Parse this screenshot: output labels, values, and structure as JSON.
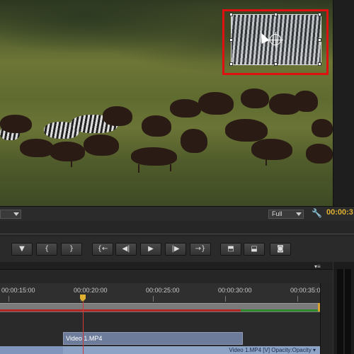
{
  "monitor": {
    "zoom_value": "Full",
    "timecode": "00:00:3",
    "left_dropdown": ""
  },
  "transport": {
    "buttons": [
      {
        "name": "add-marker",
        "glyph": "▼"
      },
      {
        "name": "mark-in",
        "glyph": "{"
      },
      {
        "name": "mark-out",
        "glyph": "}"
      },
      {
        "name": "go-to-in",
        "glyph": "{←"
      },
      {
        "name": "step-back",
        "glyph": "◀|"
      },
      {
        "name": "play",
        "glyph": "▶"
      },
      {
        "name": "step-forward",
        "glyph": "|▶"
      },
      {
        "name": "go-to-out",
        "glyph": "→}"
      },
      {
        "name": "lift",
        "glyph": "⬒"
      },
      {
        "name": "extract",
        "glyph": "⬓"
      },
      {
        "name": "export-frame",
        "glyph": "◙"
      }
    ]
  },
  "timeline": {
    "ruler_labels": [
      "00:00:15:00",
      "00:00:20:00",
      "00:00:25:00",
      "00:00:30:00",
      "00:00:35:0"
    ],
    "clip_label": "Video 1.MP4",
    "clip2_label": "Video 1.MP4 [V]  Opacity:Opacity ▾",
    "panel_menu": "▾≡"
  },
  "colors": {
    "highlight": "#e01010",
    "timecode": "#e0b030",
    "clip": "#6c7c9a"
  }
}
